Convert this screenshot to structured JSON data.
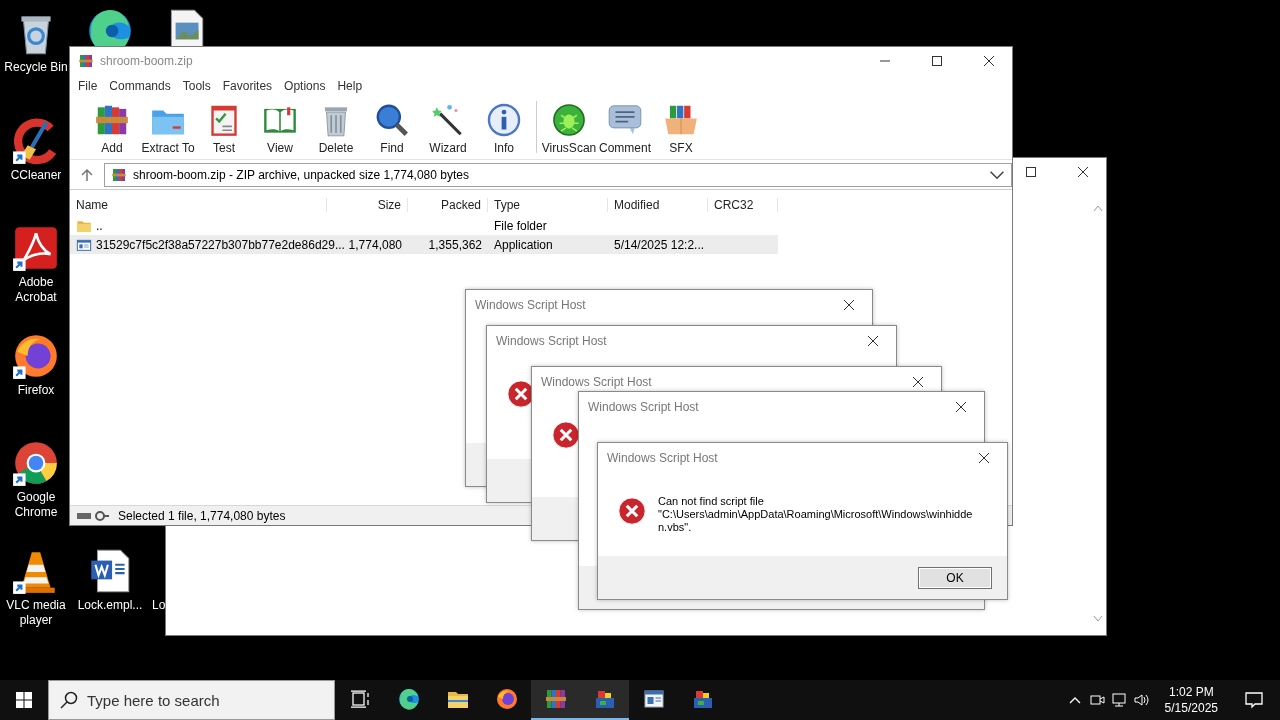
{
  "desktop_icons": [
    {
      "kind": "recycle",
      "label": "Recycle Bin"
    },
    {
      "kind": "edge"
    },
    {
      "kind": "image"
    },
    {
      "kind": "ccleaner",
      "label": "CCleaner"
    },
    {
      "kind": "acrobat",
      "label": "Adobe Acrobat"
    },
    {
      "kind": "firefox",
      "label": "Firefox"
    },
    {
      "kind": "chrome",
      "label": "Google Chrome"
    },
    {
      "kind": "vlc",
      "label": "VLC media player"
    },
    {
      "kind": "word",
      "label": "Lock.empl..."
    },
    {
      "kind": "hidden",
      "label": "Lo"
    }
  ],
  "archiver": {
    "title": "shroom-boom.zip",
    "menu": [
      "File",
      "Commands",
      "Tools",
      "Favorites",
      "Options",
      "Help"
    ],
    "toolbar": {
      "main": [
        {
          "kind": "add",
          "label": "Add"
        },
        {
          "kind": "extract",
          "label": "Extract To"
        },
        {
          "kind": "test",
          "label": "Test"
        },
        {
          "kind": "view",
          "label": "View"
        },
        {
          "kind": "delete",
          "label": "Delete"
        },
        {
          "kind": "find",
          "label": "Find"
        },
        {
          "kind": "wizard",
          "label": "Wizard"
        },
        {
          "kind": "info",
          "label": "Info"
        }
      ],
      "extra": [
        {
          "kind": "virus",
          "label": "VirusScan"
        },
        {
          "kind": "comment",
          "label": "Comment"
        },
        {
          "kind": "sfx",
          "label": "SFX"
        }
      ]
    },
    "address": "shroom-boom.zip - ZIP archive, unpacked size 1,774,080 bytes",
    "columns": [
      "Name",
      "Size",
      "Packed",
      "Type",
      "Modified",
      "CRC32"
    ],
    "rows": [
      {
        "kind": "folder",
        "selected": false,
        "cells": [
          "..",
          "",
          "",
          "File folder",
          "",
          ""
        ]
      },
      {
        "kind": "app",
        "selected": true,
        "cells": [
          "31529c7f5c2f38a57227b307bb77e2de86d29...",
          "1,774,080",
          "1,355,362",
          "Application",
          "5/14/2025 12:2...",
          ""
        ]
      }
    ],
    "status": "Selected 1 file, 1,774,080 bytes"
  },
  "dialogs": [
    {
      "title": "Windows Script Host"
    },
    {
      "title": "Windows Script Host",
      "kind": "error"
    },
    {
      "title": "Windows Script Host",
      "kind": "error"
    },
    {
      "title": "Windows Script Host"
    },
    {
      "title": "Windows Script Host",
      "kind": "error",
      "message": "Can not find script file\n\"C:\\Users\\admin\\AppData\\Roaming\\Microsoft\\Windows\\winhidden.vbs\".",
      "button": "OK"
    }
  ],
  "taskbar": {
    "search": {
      "placeholder": "Type here to search"
    },
    "apps": [
      {
        "kind": "taskview",
        "active": false
      },
      {
        "kind": "edge",
        "active": false
      },
      {
        "kind": "explorer",
        "active": false
      },
      {
        "kind": "firefox",
        "active": false
      },
      {
        "kind": "winrar",
        "active": true
      },
      {
        "kind": "wsh",
        "active": true
      },
      {
        "kind": "window",
        "active": false
      },
      {
        "kind": "wsh",
        "active": false
      }
    ],
    "clock": {
      "time": "1:02 PM",
      "date": "5/15/2025"
    }
  }
}
